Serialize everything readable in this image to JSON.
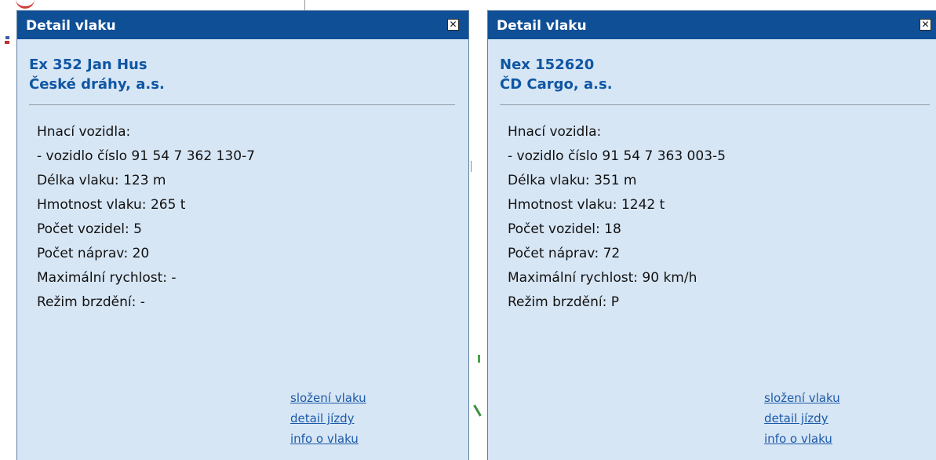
{
  "colors": {
    "header_bg": "#0f4f96",
    "panel_bg": "#d7e6f5",
    "train_title": "#0f56a3",
    "link": "#1c5aa8"
  },
  "panels": [
    {
      "title": "Detail vlaku",
      "close_icon": "close-icon",
      "close_glyph": "✕",
      "train_name": "Ex 352 Jan Hus",
      "operator": "České dráhy, a.s.",
      "info": [
        "Hnací vozidla:",
        "- vozidlo číslo 91 54 7 362 130-7",
        "Délka vlaku: 123 m",
        "Hmotnost vlaku: 265 t",
        "Počet vozidel: 5",
        "Počet náprav: 20",
        "Maximální rychlost: -",
        "Režim brzdění: -"
      ],
      "links": [
        "složení vlaku",
        "detail jízdy",
        "info o vlaku"
      ]
    },
    {
      "title": "Detail vlaku",
      "close_icon": "close-icon",
      "close_glyph": "✕",
      "train_name": "Nex 152620",
      "operator": "ČD Cargo, a.s.",
      "info": [
        "Hnací vozidla:",
        "- vozidlo číslo 91 54 7 363 003-5",
        "Délka vlaku: 351 m",
        "Hmotnost vlaku: 1242 t",
        "Počet vozidel: 18",
        "Počet náprav: 72",
        "Maximální rychlost: 90 km/h",
        "Režim brzdění: P"
      ],
      "links": [
        "složení vlaku",
        "detail jízdy",
        "info o vlaku"
      ]
    }
  ]
}
